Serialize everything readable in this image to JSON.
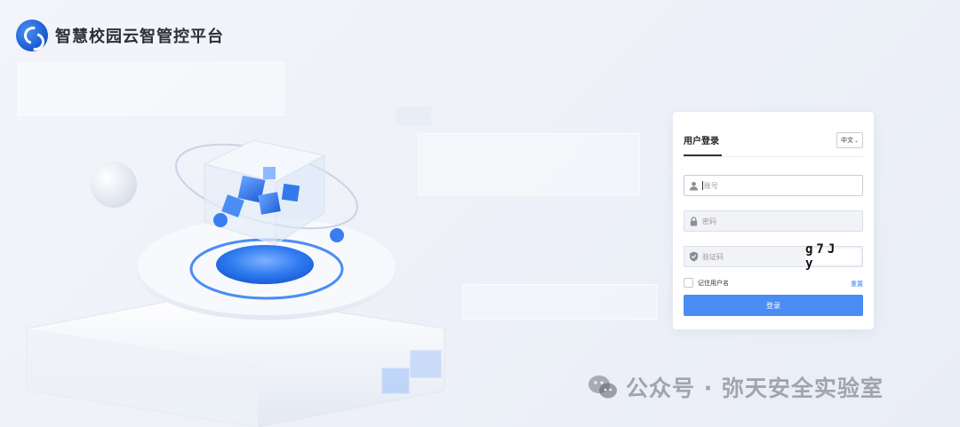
{
  "header": {
    "app_title": "智慧校园云智管控平台",
    "logo_icon": "swirl-logo"
  },
  "login": {
    "tab_label": "用户登录",
    "language": {
      "selected": "中文"
    },
    "account": {
      "placeholder": "账号",
      "icon": "user-icon"
    },
    "password": {
      "placeholder": "密码",
      "icon": "lock-icon"
    },
    "captcha": {
      "placeholder": "验证码",
      "icon": "shield-icon",
      "code": "g7J y"
    },
    "remember_label": "记住用户名",
    "reset_label": "重置",
    "submit_label": "登录"
  },
  "watermark": {
    "text": "公众号 · 弥天安全实验室",
    "icon": "wechat-icon"
  },
  "colors": {
    "accent": "#4a8df5",
    "link": "#3a7df0",
    "logo": "#1d5fd6"
  }
}
